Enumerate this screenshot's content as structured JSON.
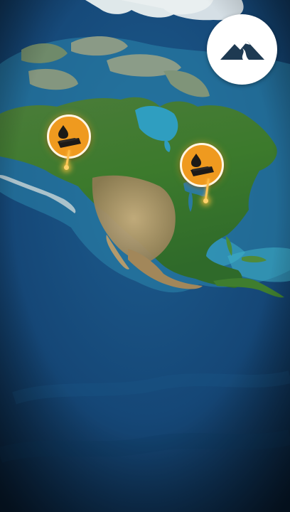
{
  "colors": {
    "ocean_deep": "#0b2642",
    "ocean_mid": "#15497a",
    "shelf_water": "#2a8fb3",
    "land_green": "#3f7a2e",
    "land_dry": "#b49a6c",
    "ice": "#e6ecec",
    "marker_orange": "#ef9a1f",
    "marker_ring": "#fff6e3",
    "marker_icon": "#1c1a17",
    "logo_bg": "#ffffff",
    "logo_mark": "#1e3a52"
  },
  "logo": {
    "icon": "mountain-river-icon"
  },
  "markers": [
    {
      "id": "marker-west",
      "icon": "oil-drop-and-coal-icon"
    },
    {
      "id": "marker-east",
      "icon": "oil-drop-and-coal-icon"
    }
  ]
}
